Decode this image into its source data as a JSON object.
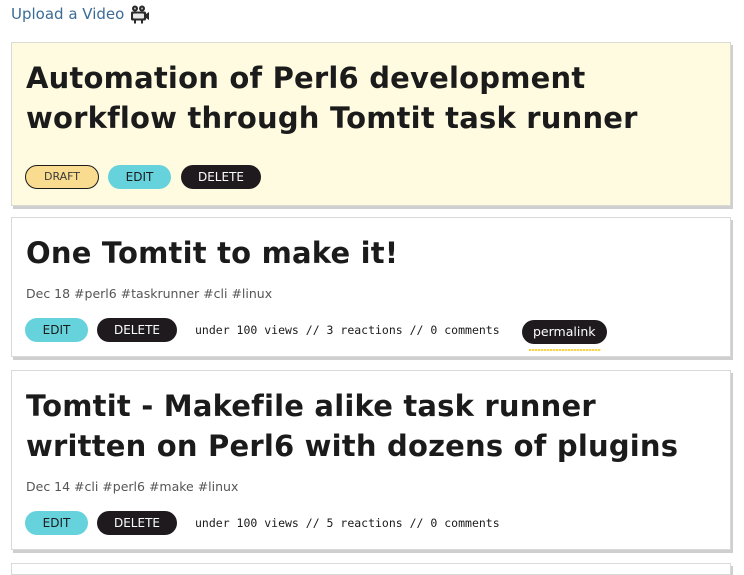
{
  "upload": {
    "label": "Upload a Video",
    "icon": "video-camera-icon"
  },
  "colors": {
    "link": "#3b6c96",
    "draft_bg": "#fffbe0",
    "draft_pill": "#f9dc8f",
    "edit_pill": "#66d2dc",
    "delete_pill": "#1f1a1e"
  },
  "posts": [
    {
      "title": "Automation of Perl6 development workflow through Tomtit task runner",
      "status": "DRAFT",
      "edit_label": "EDIT",
      "delete_label": "DELETE"
    },
    {
      "title": "One Tomtit to make it!",
      "meta": "Dec 18 #perl6 #taskrunner #cli #linux",
      "edit_label": "EDIT",
      "delete_label": "DELETE",
      "stats": "under 100 views // 3 reactions // 0 comments",
      "permalink_label": "permalink"
    },
    {
      "title": "Tomtit - Makefile alike task runner written on Perl6 with dozens of plugins",
      "meta": "Dec 14 #cli #perl6 #make #linux",
      "edit_label": "EDIT",
      "delete_label": "DELETE",
      "stats": "under 100 views // 5 reactions // 0 comments"
    }
  ]
}
